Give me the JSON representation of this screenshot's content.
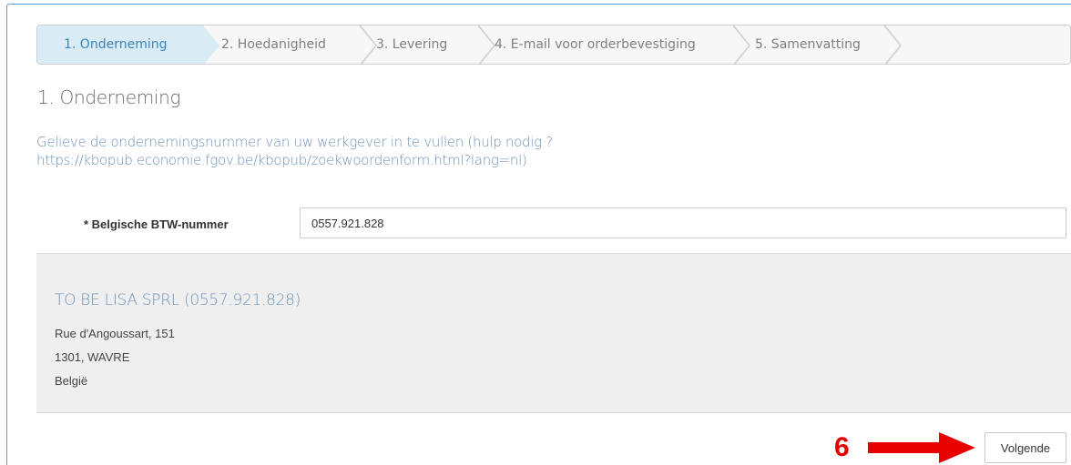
{
  "wizard": {
    "steps": [
      {
        "label": "1. Onderneming"
      },
      {
        "label": "2. Hoedanigheid"
      },
      {
        "label": "3. Levering"
      },
      {
        "label": "4. E-mail voor orderbevestiging"
      },
      {
        "label": "5. Samenvatting"
      }
    ]
  },
  "page": {
    "title": "1. Onderneming",
    "intro_line1": "Gelieve de ondernemingsnummer van uw werkgever in te vullen (hulp nodig ?",
    "intro_line2": "https://kbopub.economie.fgov.be/kbopub/zoekwoordenform.html?lang=nl)"
  },
  "form": {
    "vat_label": "* Belgische BTW-nummer",
    "vat_value": "0557.921.828"
  },
  "company": {
    "name": "TO BE LISA SPRL (0557.921.828)",
    "street": "Rue d'Angoussart, 151",
    "city": "1301, WAVRE",
    "country": "België"
  },
  "annotation": {
    "step_number": "6",
    "color": "#e60000"
  },
  "actions": {
    "next_label": "Volgende"
  },
  "colors": {
    "accent": "#3b83b8",
    "active_step_bg": "#d9ecf6",
    "link_text": "#6e93b8"
  }
}
